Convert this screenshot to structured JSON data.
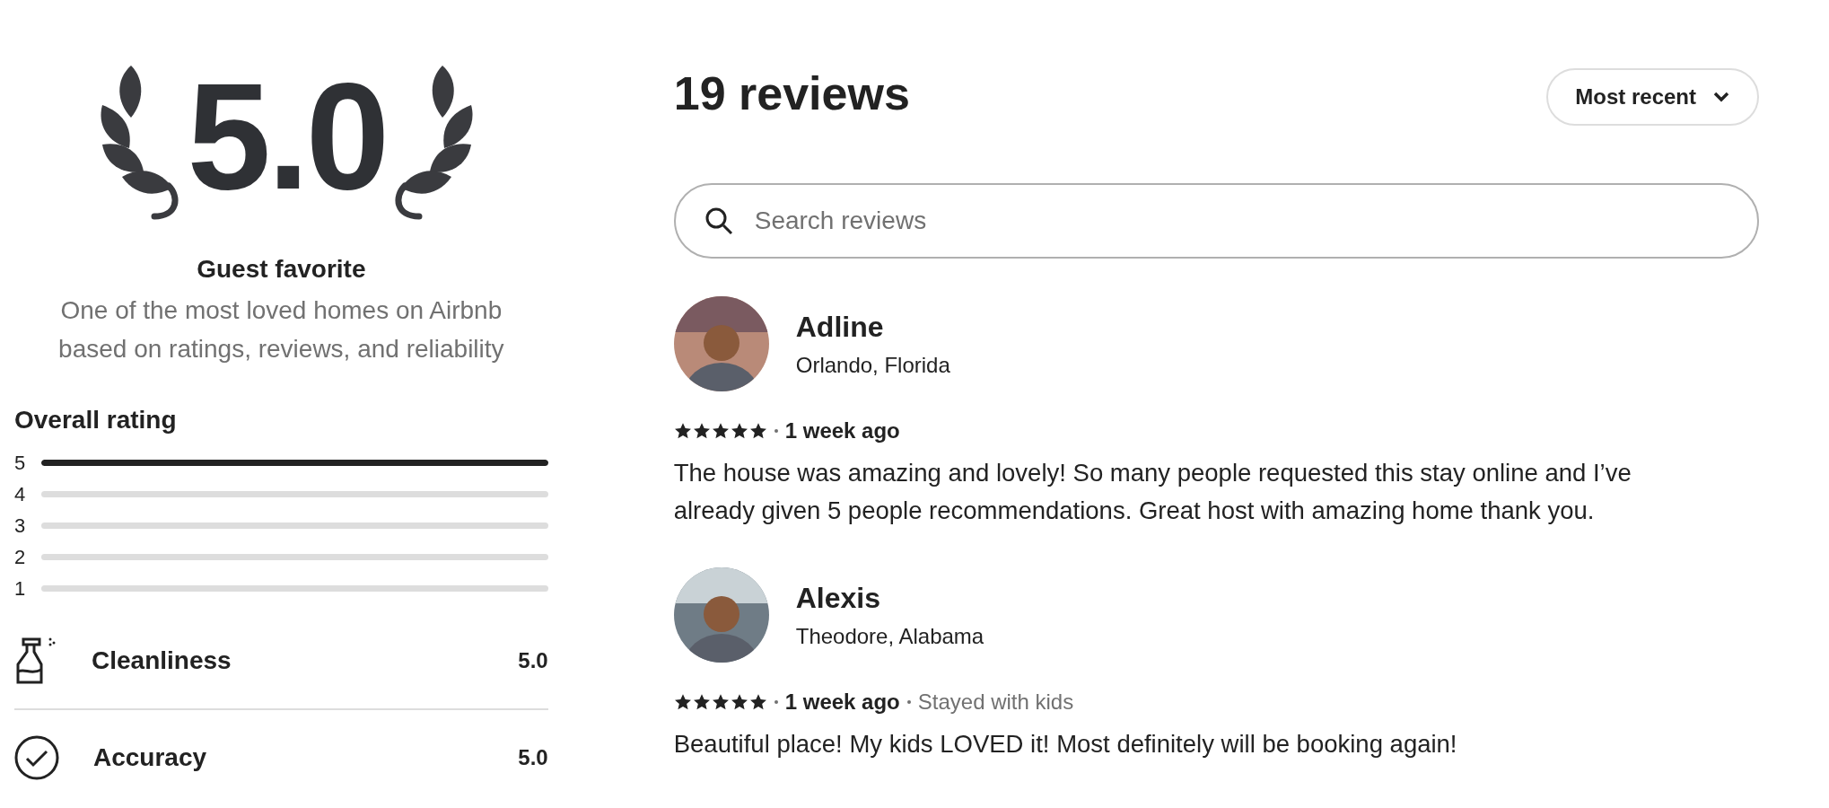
{
  "summary": {
    "score": "5.0",
    "badge": "Guest favorite",
    "description": "One of the most loved homes on Airbnb based on ratings, reviews, and reliability"
  },
  "overall_rating": {
    "title": "Overall rating",
    "bars": [
      {
        "label": "5",
        "level": 1
      },
      {
        "label": "4",
        "level": 0
      },
      {
        "label": "3",
        "level": 0
      },
      {
        "label": "2",
        "level": 0
      },
      {
        "label": "1",
        "level": 0
      }
    ]
  },
  "categories": [
    {
      "kind": "cleanliness",
      "label": "Cleanliness",
      "score": "5.0"
    },
    {
      "kind": "accuracy",
      "label": "Accuracy",
      "score": "5.0"
    }
  ],
  "reviews_header": {
    "title": "19 reviews",
    "sort": "Most recent"
  },
  "search": {
    "placeholder": "Search reviews"
  },
  "reviews": [
    {
      "name": "Adline",
      "location": "Orlando, Florida",
      "stars": 5,
      "date": "1 week ago",
      "text": "The house was amazing and lovely! So many people requested this stay online and I’ve already given 5 people recommendations. Great host with amazing home thank you."
    },
    {
      "name": "Alexis",
      "location": "Theodore, Alabama",
      "stars": 5,
      "date": "1 week ago",
      "trip": "Stayed with kids",
      "text": "Beautiful place! My kids LOVED it! Most definitely will be booking again!"
    }
  ]
}
